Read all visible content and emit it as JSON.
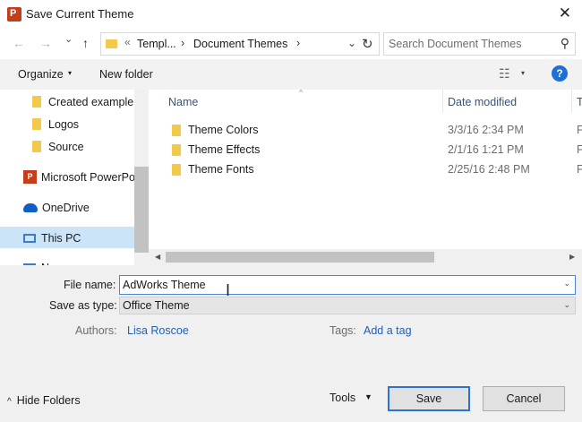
{
  "window": {
    "title": "Save Current Theme",
    "app_icon_letter": "P",
    "close_glyph": "✕"
  },
  "nav": {
    "back_glyph": "←",
    "forward_glyph": "→",
    "recent_glyph": "⌄",
    "up_glyph": "↑",
    "address": {
      "overflow": "«",
      "segments": [
        "Templ...",
        "Document Themes"
      ],
      "separator": "›",
      "dropdown_glyph": "⌄",
      "refresh_glyph": "↻"
    },
    "search": {
      "placeholder": "Search Document Themes",
      "icon_glyph": "⚲"
    }
  },
  "toolbar": {
    "organize_label": "Organize",
    "organize_caret": "▾",
    "new_folder_label": "New folder",
    "view_glyph": "☷",
    "view_caret": "▾",
    "help_label": "?"
  },
  "sidebar": {
    "items": [
      {
        "label": "Created example",
        "icon": "folder-icon"
      },
      {
        "label": "Logos",
        "icon": "folder-icon"
      },
      {
        "label": "Source",
        "icon": "folder-icon"
      },
      {
        "label": "Microsoft PowerPo",
        "icon": "powerpoint-icon"
      },
      {
        "label": "OneDrive",
        "icon": "onedrive-icon"
      },
      {
        "label": "This PC",
        "icon": "computer-icon",
        "selected": true
      },
      {
        "label": "N",
        "icon": "network-icon"
      }
    ]
  },
  "files": {
    "columns": {
      "name": "Name",
      "date": "Date modified",
      "type": "T"
    },
    "sort_glyph": "^",
    "rows": [
      {
        "name": "Theme Colors",
        "date": "3/3/16 2:34 PM",
        "type": "F"
      },
      {
        "name": "Theme Effects",
        "date": "2/1/16 1:21 PM",
        "type": "F"
      },
      {
        "name": "Theme Fonts",
        "date": "2/25/16 2:48 PM",
        "type": "F"
      }
    ]
  },
  "form": {
    "file_name_label": "File name:",
    "file_name_value": "AdWorks Theme",
    "save_as_type_label": "Save as type:",
    "save_as_type_value": "Office Theme",
    "authors_label": "Authors:",
    "authors_value": "Lisa Roscoe",
    "tags_label": "Tags:",
    "tags_value": "Add a tag",
    "caret": "⌄"
  },
  "footer": {
    "hide_folders_label": "Hide Folders",
    "hide_folders_glyph": "^",
    "tools_label": "Tools",
    "tools_caret": "▼",
    "save_label": "Save",
    "cancel_label": "Cancel"
  },
  "colors": {
    "accent": "#1e6fd6",
    "powerpoint": "#c43e1c",
    "folder": "#f3c84b",
    "selection": "#cce4f7",
    "link": "#1f5fb3"
  }
}
